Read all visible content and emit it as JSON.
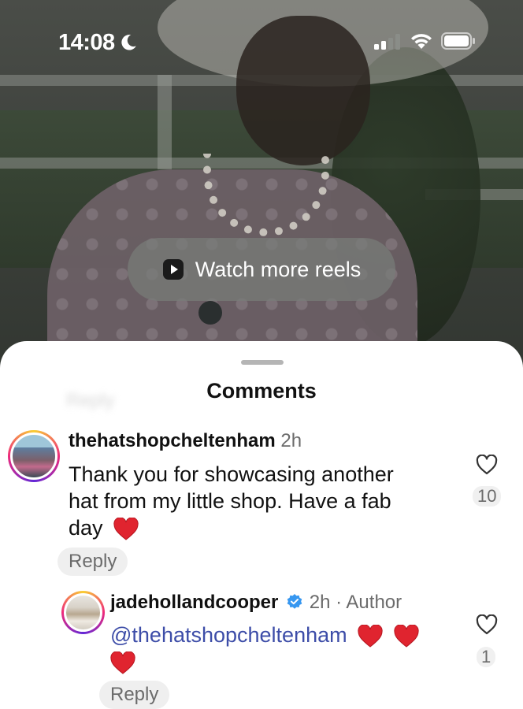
{
  "status_bar": {
    "time": "14:08"
  },
  "watch_more": {
    "label": "Watch more reels"
  },
  "sheet": {
    "title": "Comments",
    "ghost_reply": "Reply"
  },
  "comments": [
    {
      "username": "thehatshopcheltenham",
      "time": "2h",
      "text_line1": "Thank you for showcasing another",
      "text_line2": "hat from my little shop. Have a fab",
      "text_line3": "day",
      "likes": "10",
      "reply_label": "Reply"
    },
    {
      "username": "jadehollandcooper",
      "time_author": "2h · Author",
      "mention": "@thehatshopcheltenham",
      "likes": "1",
      "reply_label": "Reply"
    }
  ],
  "colors": {
    "mention": "#3d4da8",
    "heart": "#e0242f",
    "verified": "#3797f0"
  },
  "icons": [
    "moon-icon",
    "cellular-signal-icon",
    "wifi-icon",
    "battery-icon",
    "play-icon",
    "heart-outline-icon",
    "verified-badge-icon",
    "red-heart-emoji"
  ]
}
